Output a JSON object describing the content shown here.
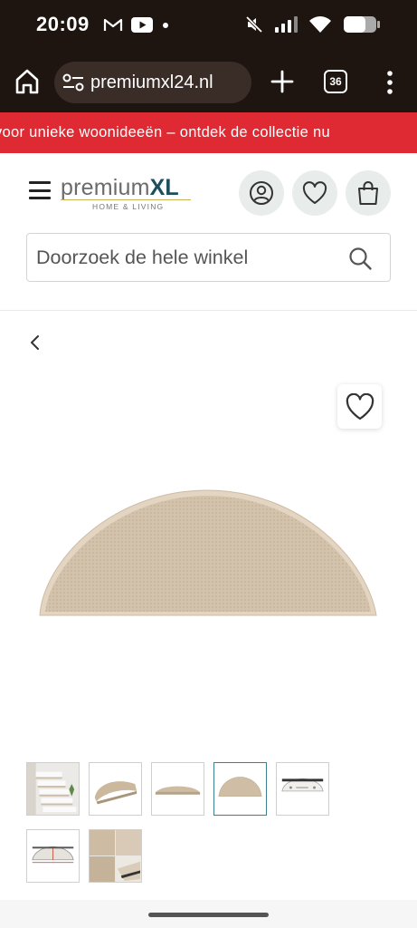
{
  "status_bar": {
    "time": "20:09",
    "left_icons": [
      "gmail-icon",
      "youtube-icon",
      "dot-icon"
    ],
    "right_icons": [
      "mute-icon",
      "signal-icon",
      "wifi-icon",
      "battery-icon"
    ]
  },
  "browser": {
    "url": "premiumxl24.nl",
    "tab_count": "36"
  },
  "promo": {
    "text": "voor unieke woonideeën – ontdek de collectie nu"
  },
  "header": {
    "logo_left": "premium",
    "logo_right": "XL",
    "logo_tagline": "HOME & LIVING",
    "search_placeholder": "Doorzoek de hele winkel"
  },
  "product": {
    "image_color": "#d3c2ab",
    "thumbnails": [
      {
        "name": "thumb-stairs-photo",
        "active": false
      },
      {
        "name": "thumb-mat-angle",
        "active": false
      },
      {
        "name": "thumb-mat-side",
        "active": false
      },
      {
        "name": "thumb-mat-top",
        "active": true
      },
      {
        "name": "thumb-mat-underside",
        "active": false
      },
      {
        "name": "thumb-mat-dimensions",
        "active": false
      },
      {
        "name": "thumb-mat-detail",
        "active": false
      }
    ]
  },
  "colors": {
    "status_bg": "#1e1410",
    "promo_red": "#e02a33",
    "brand_teal": "#1d4e5e",
    "icon_circle": "#e8edeb",
    "active_border": "#3a7f93"
  }
}
